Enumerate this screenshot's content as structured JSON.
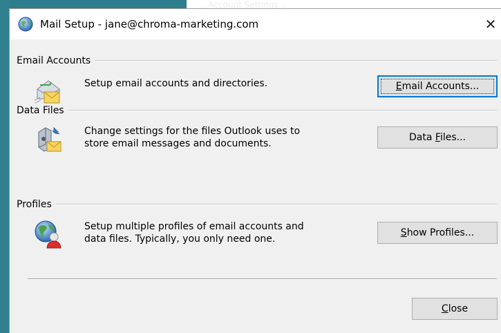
{
  "background_window": {
    "title_fragment": "...Account Settings..."
  },
  "dialog": {
    "title": "Mail Setup - jane@chroma-marketing.com",
    "close_glyph": "✕",
    "sections": [
      {
        "legend": "Email Accounts",
        "description_line1": "Setup email accounts and directories.",
        "description_line2": "",
        "button_pre": "",
        "button_key": "E",
        "button_post": "mail Accounts...",
        "icon": "email-accounts-icon"
      },
      {
        "legend": "Data Files",
        "description_line1": "Change settings for the files Outlook uses to",
        "description_line2": "store email messages and documents.",
        "button_pre": "Data ",
        "button_key": "F",
        "button_post": "iles...",
        "icon": "data-files-icon"
      },
      {
        "legend": "Profiles",
        "description_line1": "Setup multiple profiles of email accounts and",
        "description_line2": "data files. Typically, you only need one.",
        "button_pre": "",
        "button_key": "S",
        "button_post": "how Profiles...",
        "icon": "profiles-icon"
      }
    ],
    "close_button": {
      "pre": "",
      "key": "C",
      "post": "lose"
    }
  },
  "colors": {
    "desktop": "#2e7d8c",
    "dialog_bg": "#f0f0f0",
    "button_bg": "#e1e1e1",
    "focus_border": "#0078d7"
  }
}
